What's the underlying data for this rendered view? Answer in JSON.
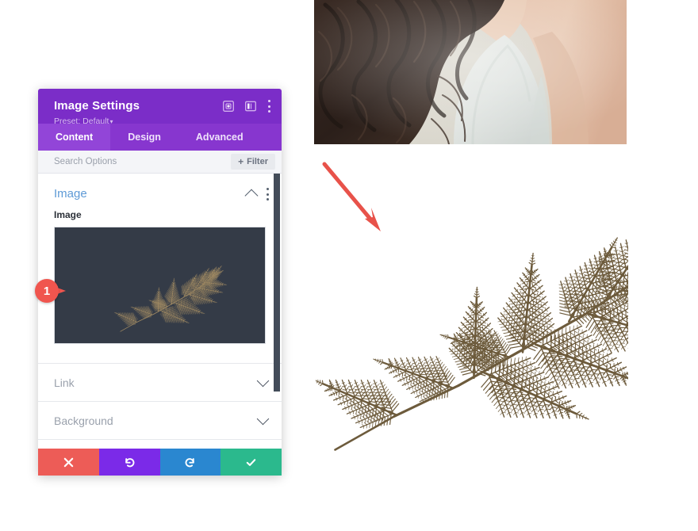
{
  "panel": {
    "title": "Image Settings",
    "preset": "Preset: Default",
    "preset_caret": "▾",
    "header_icons": [
      {
        "name": "focus-icon",
        "label": "Focus"
      },
      {
        "name": "layout-icon",
        "label": "Layout"
      },
      {
        "name": "more-options-icon",
        "label": "More options"
      }
    ],
    "tabs": [
      {
        "label": "Content",
        "active": true
      },
      {
        "label": "Design",
        "active": false
      },
      {
        "label": "Advanced",
        "active": false
      }
    ],
    "search": {
      "placeholder": "Search Options",
      "value": ""
    },
    "filter_button": {
      "plus": "+",
      "label": "Filter"
    },
    "sections": [
      {
        "title": "Image",
        "expanded": true,
        "fields": [
          {
            "label": "Image",
            "type": "image-upload",
            "preview_bg": "#343b47",
            "preview_art": "fern"
          }
        ]
      },
      {
        "title": "Link",
        "expanded": false
      },
      {
        "title": "Background",
        "expanded": false
      }
    ],
    "footer_buttons": [
      {
        "name": "cancel-button",
        "icon": "close-icon",
        "color": "#ed5c57"
      },
      {
        "name": "undo-button",
        "icon": "undo-icon",
        "color": "#7b2ae8"
      },
      {
        "name": "redo-button",
        "icon": "redo-icon",
        "color": "#2a87d0"
      },
      {
        "name": "save-button",
        "icon": "check-icon",
        "color": "#2bb98d"
      }
    ]
  },
  "annotations": {
    "badge_number": "1",
    "badge_color": "#f0554e",
    "arrow_color": "#e8524a"
  },
  "media": {
    "photo": {
      "name": "bride-photo",
      "description": "Woman with dark wavy hair in white one-shoulder dress"
    },
    "fern": {
      "name": "fern-leaf-image",
      "description": "Brown pressed fern leaf on white background",
      "color": "#6d5b3c"
    }
  },
  "colors": {
    "header_purple": "#7b2dc8",
    "tabbar_purple": "#8736cf",
    "tab_active_purple": "#9245d8",
    "section_title_blue": "#5e9ad6"
  }
}
